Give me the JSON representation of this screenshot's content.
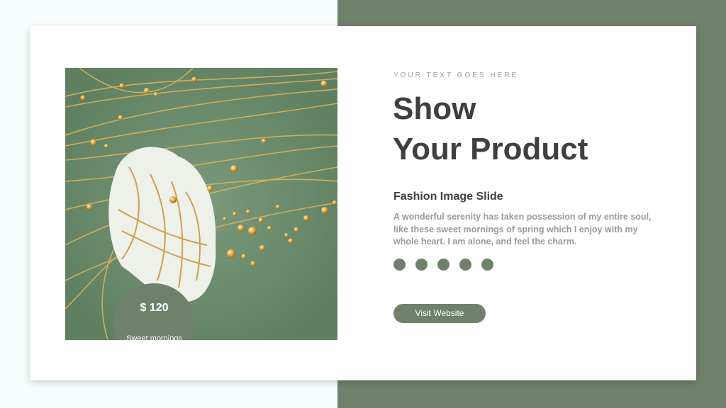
{
  "theme": {
    "accent": "#6f816b",
    "background": "#f5fdfd",
    "card": "#ffffff",
    "text_dark": "#3f3f3f",
    "text_muted": "#9a9a9a"
  },
  "product": {
    "price": "$ 120",
    "caption": "Sweet mornings",
    "image_icon": "gold-lines-flower-art"
  },
  "content": {
    "eyebrow": "YOUR TEXT GOES HERE",
    "title_line1": "Show",
    "title_line2": "Your Product",
    "subtitle": "Fashion Image Slide",
    "description": "A wonderful serenity has taken possession of my entire soul, like these sweet mornings of spring which I enjoy with my whole heart. I am alone, and feel the charm.",
    "dot_count": 5,
    "button_label": "Visit Website"
  }
}
